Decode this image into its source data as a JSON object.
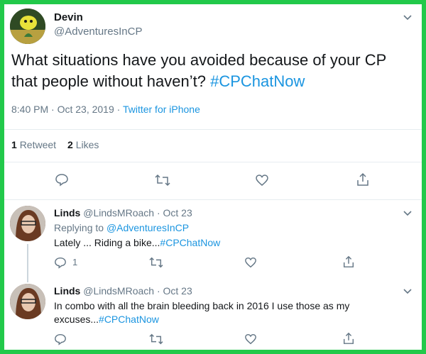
{
  "tweet": {
    "author_name": "Devin",
    "author_handle": "@AdventuresInCP",
    "text_line1": "What situations have you avoided because of your CP",
    "text_line2_plain": "that people without haven’t? ",
    "hashtag": "#CPChatNow",
    "timestamp": "8:40 PM · Oct 23, 2019 · ",
    "source": "Twitter for iPhone",
    "retweets_count": "1",
    "retweets_label": "Retweet",
    "likes_count": "2",
    "likes_label": "Likes"
  },
  "replies": [
    {
      "author_name": "Linds",
      "author_handle": "@LindsMRoach",
      "date": "· Oct 23",
      "replying_prefix": "Replying to ",
      "replying_handle": "@AdventuresInCP",
      "text": "Lately ... Riding a bike...",
      "hashtag": "#CPChatNow",
      "reply_count": "1"
    },
    {
      "author_name": "Linds",
      "author_handle": "@LindsMRoach",
      "date": "· Oct 23",
      "text_line1": "In combo with all the brain bleeding back in 2016 I use those as my",
      "text_line2": "excuses...",
      "hashtag": "#CPChatNow"
    }
  ],
  "colors": {
    "border": "#22c94a",
    "link": "#1b95e0",
    "muted": "#657786"
  },
  "icons": [
    "chevron-down-icon",
    "reply-icon",
    "retweet-icon",
    "like-icon",
    "share-icon"
  ]
}
